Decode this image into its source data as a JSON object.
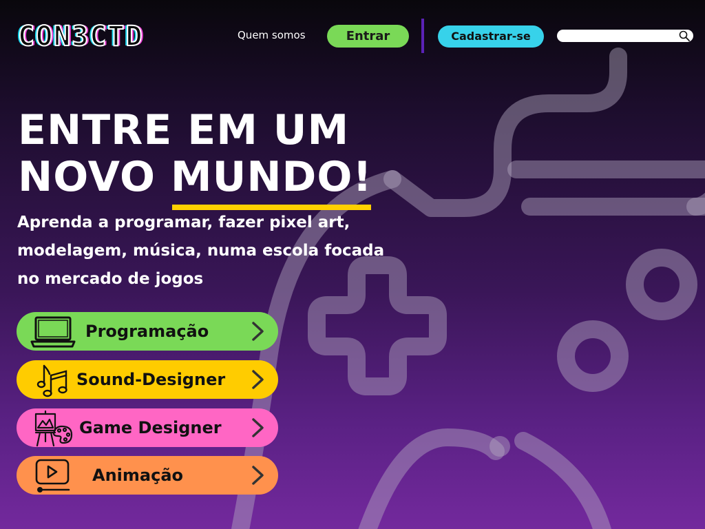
{
  "header": {
    "logo": "CON3CTD",
    "nav_about": "Quem somos",
    "login_label": "Entrar",
    "signup_label": "Cadastrar-se",
    "search": {
      "value": "",
      "placeholder": ""
    }
  },
  "hero": {
    "headline_line1": "ENTRE EM UM",
    "headline_line2_a": "NOVO ",
    "headline_line2_b": "MUNDO!",
    "subtitle": "Aprenda a programar, fazer pixel art, modelagem, música, numa escola focada no mercado de jogos"
  },
  "categories": [
    {
      "label": "Programação",
      "icon": "laptop-icon",
      "color": "#7ad957"
    },
    {
      "label": "Sound-Designer",
      "icon": "music-notes-icon",
      "color": "#ffcc00"
    },
    {
      "label": "Game Designer",
      "icon": "easel-palette-icon",
      "color": "#ff66c4"
    },
    {
      "label": "Animação",
      "icon": "video-player-icon",
      "color": "#ff914d"
    }
  ],
  "colors": {
    "accent_green": "#7ad957",
    "accent_cyan": "#37d2ea",
    "accent_yellow": "#ffd000",
    "divider_purple": "#5b22b6"
  }
}
